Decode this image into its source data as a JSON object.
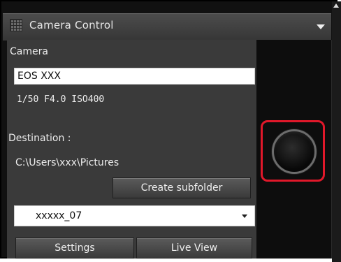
{
  "window": {
    "title": "Camera Control"
  },
  "camera": {
    "section_label": "Camera",
    "model": "EOS XXX",
    "settings_readout": "1/50  F4.0  ISO400"
  },
  "destination": {
    "label": "Destination :",
    "path": "C:\\Users\\xxx\\Pictures",
    "create_subfolder_label": "Create subfolder",
    "selected_folder": "xxxxx_07"
  },
  "buttons": {
    "settings": "Settings",
    "live_view": "Live View"
  },
  "colors": {
    "highlight": "#e0182a"
  },
  "icons": {
    "title_grip": "grip-icon",
    "collapse": "collapse-icon",
    "select_dropdown": "chevron-down-icon",
    "shutter": "shutter-button"
  }
}
